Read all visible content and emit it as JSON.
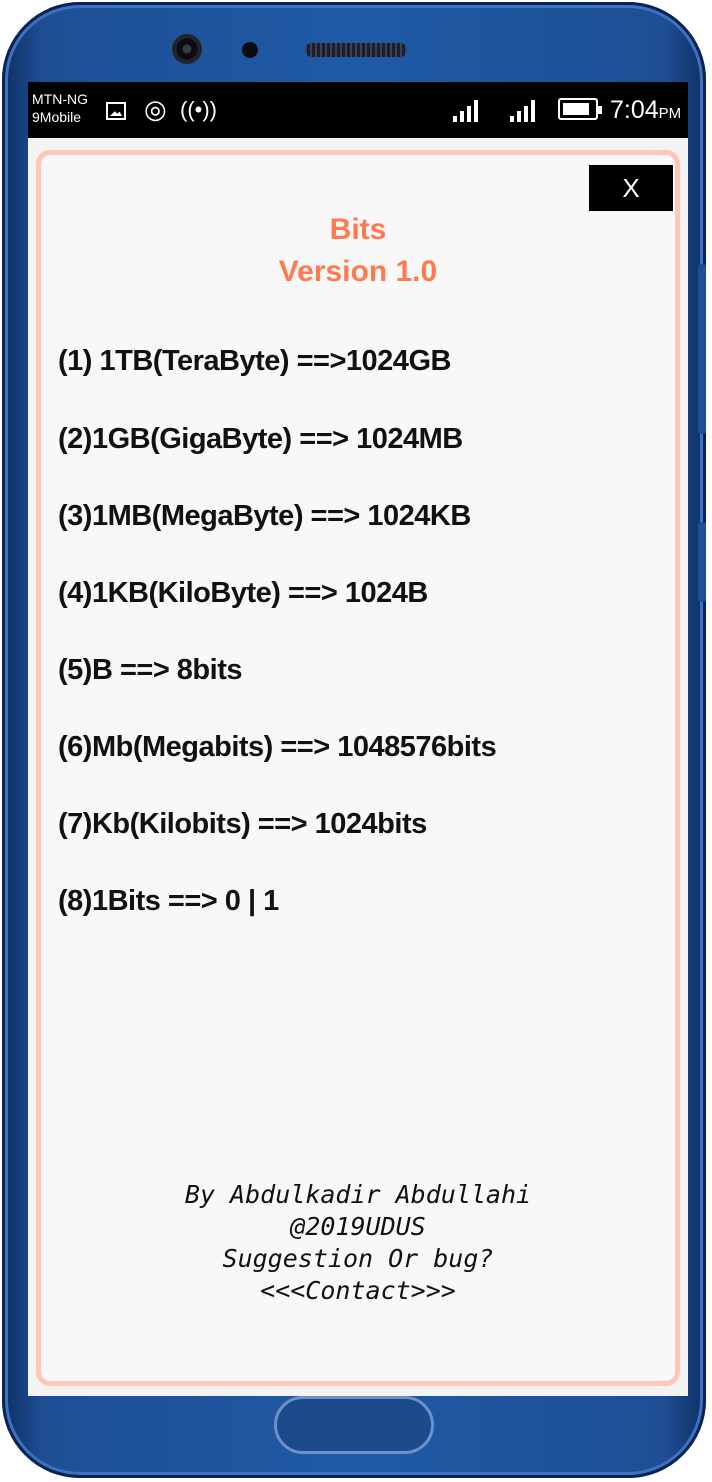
{
  "status_bar": {
    "carrier_line1": "MTN-NG",
    "carrier_line2": "9Mobile",
    "hotspot_icon_glyph": "◎",
    "cast_icon_glyph": "((•))",
    "time": "7:04",
    "ampm": "PM",
    "icons": [
      "image-icon",
      "hotspot-icon",
      "cast-icon",
      "signal-icon",
      "signal-icon",
      "battery-icon"
    ],
    "battery_level": 0.85
  },
  "dialog": {
    "close_label": "X",
    "title": "Bits",
    "version": "Version 1.0",
    "rules": [
      "(1) 1TB(TeraByte) ==>1024GB",
      "(2)1GB(GigaByte) ==> 1024MB",
      "(3)1MB(MegaByte) ==> 1024KB",
      "(4)1KB(KiloByte) ==> 1024B",
      "(5)B ==> 8bits",
      "(6)Mb(Megabits) ==> 1048576bits",
      "(7)Kb(Kilobits) ==> 1024bits",
      "(8)1Bits ==> 0 | 1"
    ],
    "footer": {
      "author": "By Abdulkadir Abdullahi",
      "handle": "@2019UDUS",
      "suggestion": "Suggestion Or bug?",
      "contact": "<<<Contact>>>"
    }
  },
  "colors": {
    "title": "#ff7a4d",
    "card_border": "#ffc6b5",
    "phone_frame": "#1f5aa5"
  }
}
